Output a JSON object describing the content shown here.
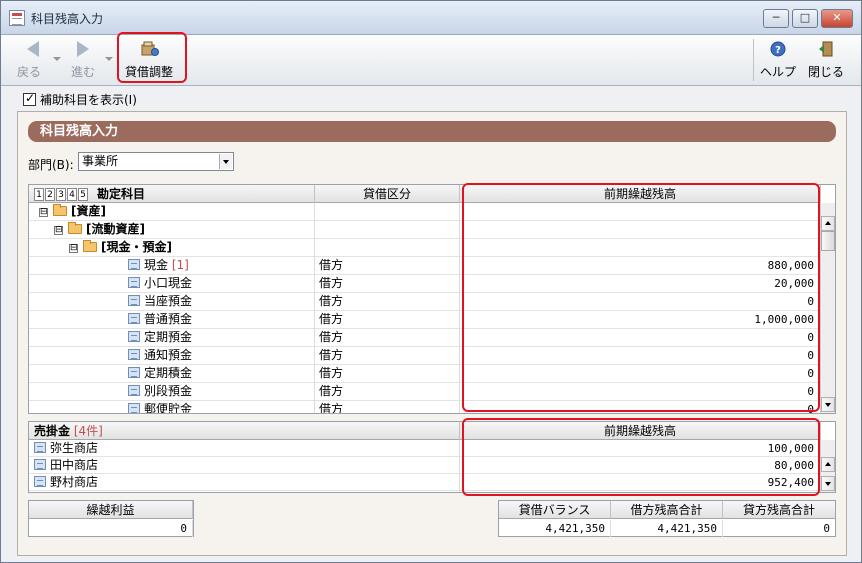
{
  "window": {
    "title": "科目残高入力",
    "minimize": "─",
    "maximize": "□",
    "close": "✕"
  },
  "toolbar": {
    "back": "戻る",
    "forward": "進む",
    "adjust": "貸借調整",
    "help": "ヘルプ",
    "close": "閉じる"
  },
  "options": {
    "show_sub_accounts": "補助科目を表示(I)",
    "show_sub_accounts_checked": true
  },
  "panel": {
    "title": "科目残高入力",
    "dept_label": "部門(B):",
    "dept_value": "事業所"
  },
  "account_grid": {
    "level_buttons": [
      "1",
      "2",
      "3",
      "4",
      "5"
    ],
    "columns": [
      "勘定科目",
      "貸借区分",
      "前期繰越残高"
    ],
    "rows": [
      {
        "indent": 0,
        "type": "group",
        "toggle": "⊟",
        "name": "[資産]",
        "side": "",
        "balance": ""
      },
      {
        "indent": 1,
        "type": "group",
        "toggle": "⊟",
        "name": "[流動資産]",
        "side": "",
        "balance": ""
      },
      {
        "indent": 2,
        "type": "group",
        "toggle": "⊟",
        "name": "[現金・預金]",
        "side": "",
        "balance": ""
      },
      {
        "indent": 3,
        "type": "item",
        "name": "現金",
        "tag": "[1]",
        "side": "借方",
        "balance": "880,000"
      },
      {
        "indent": 3,
        "type": "item",
        "name": "小口現金",
        "tag": "",
        "side": "借方",
        "balance": "20,000"
      },
      {
        "indent": 3,
        "type": "item",
        "name": "当座預金",
        "tag": "",
        "side": "借方",
        "balance": "0"
      },
      {
        "indent": 3,
        "type": "item",
        "name": "普通預金",
        "tag": "",
        "side": "借方",
        "balance": "1,000,000"
      },
      {
        "indent": 3,
        "type": "item",
        "name": "定期預金",
        "tag": "",
        "side": "借方",
        "balance": "0"
      },
      {
        "indent": 3,
        "type": "item",
        "name": "通知預金",
        "tag": "",
        "side": "借方",
        "balance": "0"
      },
      {
        "indent": 3,
        "type": "item",
        "name": "定期積金",
        "tag": "",
        "side": "借方",
        "balance": "0"
      },
      {
        "indent": 3,
        "type": "item",
        "name": "別段預金",
        "tag": "",
        "side": "借方",
        "balance": "0"
      },
      {
        "indent": 3,
        "type": "item",
        "name": "郵便貯金",
        "tag": "",
        "side": "借方",
        "balance": "0"
      }
    ]
  },
  "sub_grid": {
    "title": "売掛金",
    "count": "[4件]",
    "balance_header": "前期繰越残高",
    "rows": [
      {
        "name": "弥生商店",
        "balance": "100,000"
      },
      {
        "name": "田中商店",
        "balance": "80,000"
      },
      {
        "name": "野村商店",
        "balance": "952,400"
      }
    ]
  },
  "summary": {
    "retained_label": "繰越利益",
    "retained_value": "0",
    "balance_label": "貸借バランス",
    "balance_value": "4,421,350",
    "debit_total_label": "借方残高合計",
    "debit_total_value": "4,421,350",
    "credit_total_label": "貸方残高合計",
    "credit_total_value": "0"
  },
  "colors": {
    "panel_header": "#9b6b5e",
    "highlight": "#e0141e",
    "accent_text": "#c0504d"
  }
}
